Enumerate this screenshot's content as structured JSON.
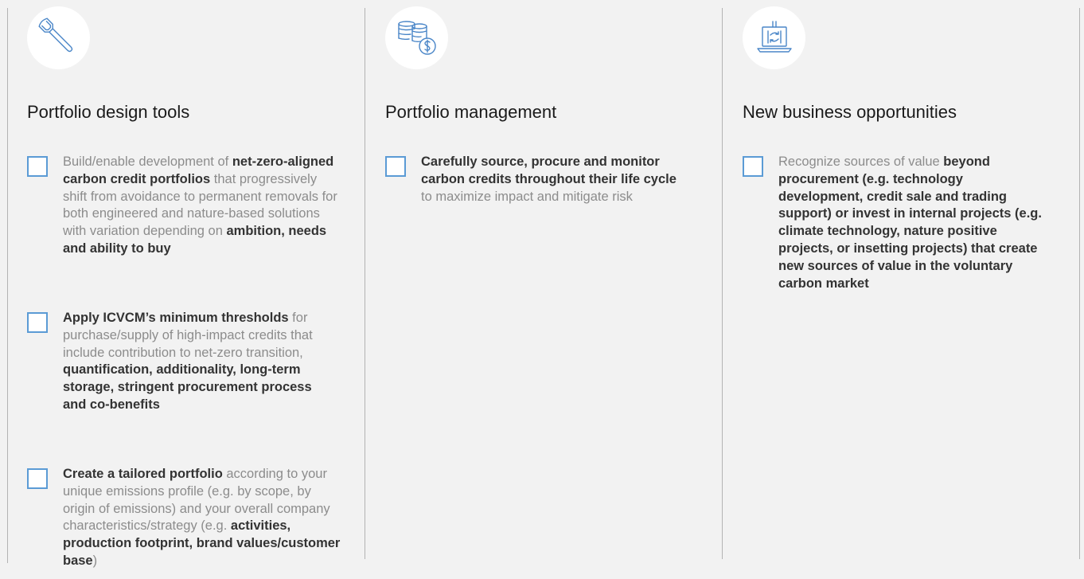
{
  "columns": [
    {
      "title": "Portfolio design tools",
      "icon": "wrench-icon",
      "items": [
        {
          "segments": [
            {
              "text": "Build/enable development of ",
              "bold": false
            },
            {
              "text": "net-zero-aligned carbon credit portfolios",
              "bold": true
            },
            {
              "text": " that progressively shift from avoidance to permanent removals for both engineered and nature-based solutions with variation depending on ",
              "bold": false
            },
            {
              "text": "ambition, needs and ability to buy",
              "bold": true
            }
          ]
        },
        {
          "segments": [
            {
              "text": "Apply ICVCM’s minimum thresholds",
              "bold": true
            },
            {
              "text": " for purchase/supply of high-impact credits that include contribution to net-zero transition, ",
              "bold": false
            },
            {
              "text": "quantification, additionality, long-term storage, stringent procurement process and co-benefits",
              "bold": true
            }
          ]
        },
        {
          "segments": [
            {
              "text": "Create a tailored portfolio",
              "bold": true
            },
            {
              "text": " according to your unique emissions profile (e.g. by scope, by origin of emissions) and your overall company characteristics/strategy (e.g. ",
              "bold": false
            },
            {
              "text": "activities, production footprint, brand values/customer base",
              "bold": true
            },
            {
              "text": ")",
              "bold": false
            }
          ]
        }
      ]
    },
    {
      "title": "Portfolio management",
      "icon": "coins-dollar-icon",
      "items": [
        {
          "segments": [
            {
              "text": "Carefully source, procure and monitor carbon credits throughout their life cycle",
              "bold": true
            },
            {
              "text": " to maximize impact and mitigate risk",
              "bold": false
            }
          ]
        }
      ]
    },
    {
      "title": "New business opportunities",
      "icon": "laptop-exchange-icon",
      "items": [
        {
          "segments": [
            {
              "text": "Recognize sources of value ",
              "bold": false
            },
            {
              "text": "beyond procurement (e.g. technology development, credit sale and trading support) or invest in internal projects (e.g. climate technology, nature positive projects, or insetting projects) that create new sources of value in the voluntary carbon market",
              "bold": true
            }
          ]
        }
      ]
    }
  ],
  "colors": {
    "background": "#f2f2f2",
    "checkbox_border": "#5b9bd5",
    "icon_stroke": "#4a86c8",
    "body_text": "#8c8c8c",
    "bold_text": "#333333",
    "title_text": "#1a1a1a",
    "divider": "#b3b3b3"
  }
}
